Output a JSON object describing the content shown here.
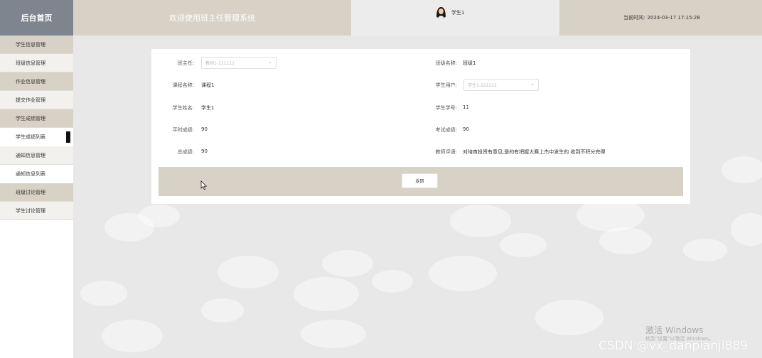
{
  "sidebar": {
    "brand": "后台首页",
    "items": [
      {
        "label": "学生信息管理"
      },
      {
        "label": "班级信息管理"
      },
      {
        "label": "作业信息管理"
      },
      {
        "label": "提交作业管理"
      },
      {
        "label": "学生成绩管理"
      }
    ],
    "sub_items": [
      {
        "label": "学生成绩列表"
      },
      {
        "label": "通知信息管理"
      },
      {
        "label": "通知信息列表"
      }
    ],
    "items_after": [
      {
        "label": "班级讨论管理"
      },
      {
        "label": "学生讨论管理"
      }
    ]
  },
  "header": {
    "welcome": "欢迎使用班主任管理系统",
    "username": "学生1",
    "time_label": "当前时间:",
    "time_value": "2024-03-17 17:15:28"
  },
  "form": {
    "teacher_label": "班主任:",
    "teacher_value": "教师1-111111",
    "class_label": "班级名称:",
    "class_value": "班级1",
    "course_label": "课程名称:",
    "course_value": "课程1",
    "student_user_label": "学生用户:",
    "student_user_value": "学生1-222222",
    "student_name_label": "学生姓名:",
    "student_name_value": "学生1",
    "student_no_label": "学生学号:",
    "student_no_value": "11",
    "regular_score_label": "平时成绩:",
    "regular_score_value": "90",
    "exam_score_label": "考试成绩:",
    "exam_score_value": "90",
    "total_score_label": "总成绩:",
    "total_score_value": "90",
    "teacher_comment_label": "教师评语:",
    "teacher_comment_value": "对培育投资有意见,是的有把握大赛上杰中发生的 收到不积分完得",
    "back_button": "返回"
  },
  "watermarks": {
    "windows": "激活 Windows",
    "windows_sub": "转到\"设置\"以激活 Windows。",
    "csdn": "CSDN @vx_danpianji889"
  }
}
